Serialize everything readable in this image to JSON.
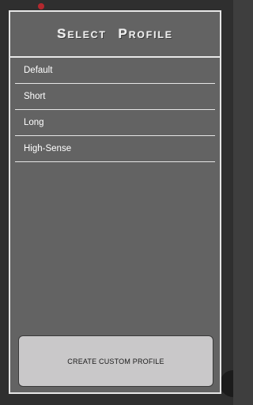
{
  "dialog": {
    "title": "Select Profile",
    "profiles": [
      {
        "label": "Default"
      },
      {
        "label": "Short"
      },
      {
        "label": "Long"
      },
      {
        "label": "High-Sense"
      }
    ],
    "create_button_label": "CREATE CUSTOM PROFILE"
  },
  "colors": {
    "dialog_background": "#636363",
    "dialog_border": "#e6e6e6",
    "button_background": "#c9c8c9",
    "backdrop": "#2f2f2f"
  }
}
